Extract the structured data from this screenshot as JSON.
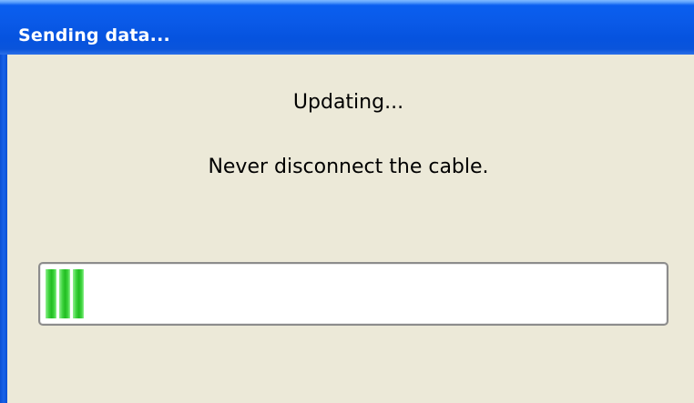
{
  "window": {
    "title": "Sending data..."
  },
  "message": {
    "status": "Updating...",
    "warning": "Never disconnect the cable."
  },
  "progress": {
    "percent": 7,
    "color": "#22bd22"
  }
}
